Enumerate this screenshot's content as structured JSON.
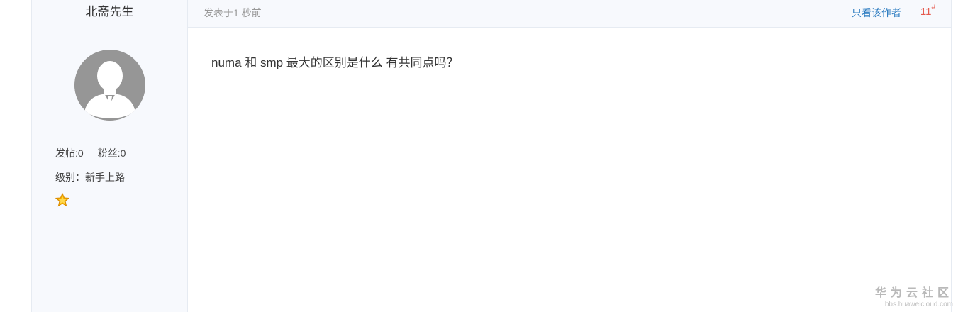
{
  "author": {
    "name": "北斋先生",
    "posts_label": "发帖:0",
    "fans_label": "粉丝:0",
    "level_label": "级别：新手上路",
    "badge_icon": "star-icon"
  },
  "post": {
    "posted_time": "发表于1 秒前",
    "only_author_label": "只看该作者",
    "floor": "11",
    "floor_mark": "#",
    "body": "numa 和 smp 最大的区别是什么 有共同点吗？"
  },
  "watermark": {
    "title": "华为云社区",
    "url": "bbs.huaweicloud.com"
  },
  "colors": {
    "sidebar_bg": "#f7f9fd",
    "link": "#2a7ac0",
    "floor": "#e55a4e",
    "avatar": "#9c9c9c"
  }
}
